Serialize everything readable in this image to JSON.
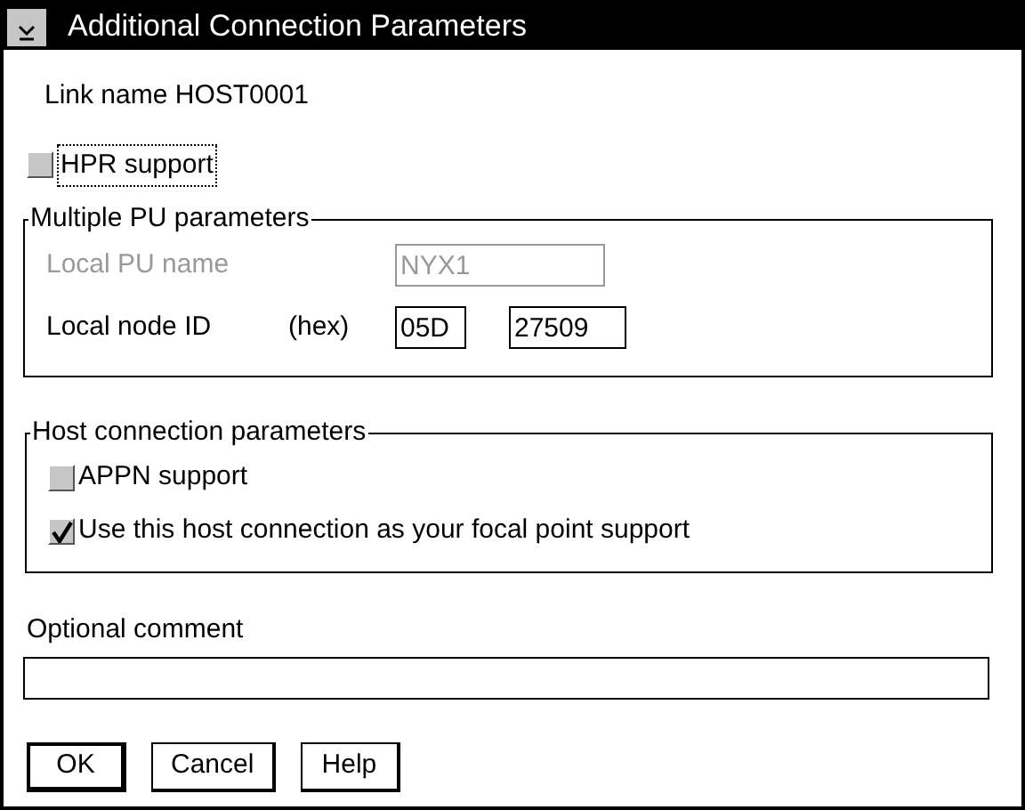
{
  "window": {
    "title": "Additional Connection Parameters"
  },
  "link_name": "Link name HOST0001",
  "hpr_support": {
    "label": "HPR support",
    "checked": false
  },
  "multiple_pu": {
    "title": "Multiple PU parameters",
    "local_pu_name": {
      "label": "Local PU name",
      "value": "NYX1",
      "disabled": true
    },
    "local_node_id": {
      "label": "Local node ID",
      "unit": "(hex)",
      "value_1": "05D",
      "value_2": "27509"
    }
  },
  "host_connection": {
    "title": "Host connection parameters",
    "options": [
      {
        "label": "APPN support",
        "checked": false
      },
      {
        "label": "Use this host connection as your focal point support",
        "checked": true
      }
    ]
  },
  "comment": {
    "label": "Optional comment"
  },
  "buttons": [
    {
      "label": "OK",
      "default": true
    },
    {
      "label": "Cancel",
      "default": false
    },
    {
      "label": "Help",
      "default": false
    }
  ]
}
